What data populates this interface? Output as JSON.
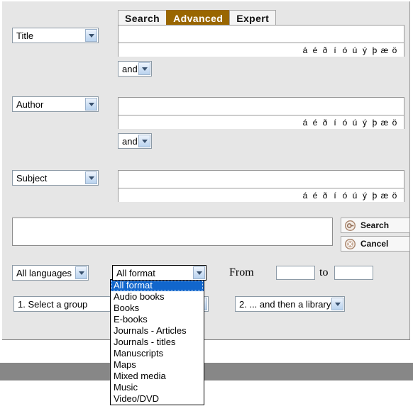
{
  "tabs": [
    {
      "label": "Search",
      "active": false
    },
    {
      "label": "Advanced",
      "active": true
    },
    {
      "label": "Expert",
      "active": false
    }
  ],
  "accents": [
    "á",
    "é",
    "ð",
    "í",
    "ó",
    "ú",
    "ý",
    "þ",
    "æ",
    "ö"
  ],
  "rows": [
    {
      "field_select": "Title",
      "field_value": "",
      "boolean_select": "and"
    },
    {
      "field_select": "Author",
      "field_value": "",
      "boolean_select": "and"
    },
    {
      "field_select": "Subject",
      "field_value": "",
      "boolean_select": ""
    }
  ],
  "freetext": {
    "value": ""
  },
  "buttons": {
    "search_label": "Search",
    "search_icon": "search-circle-icon",
    "cancel_label": "Cancel",
    "cancel_icon": "cancel-circle-icon"
  },
  "filters": {
    "language_select": "All languages",
    "format_select": "All format",
    "from_label": "From",
    "from_value": "",
    "to_label": "to",
    "to_value": "",
    "group_select": "1. Select a group",
    "library_select": "2. ... and then a library"
  },
  "format_options": [
    "All format",
    "Audio books",
    "Books",
    "E-books",
    "Journals - Articles",
    "Journals - titles",
    "Manuscripts",
    "Maps",
    "Mixed media",
    "Music",
    "Video/DVD"
  ],
  "format_selected_index": 0,
  "colors": {
    "active_tab_bg": "#996600",
    "active_tab_fg": "#ffffff",
    "panel_bg": "#e6e6e6",
    "list_highlight": "#1166cc",
    "footer_bar": "#878787",
    "button_icon": "#a8836a"
  }
}
